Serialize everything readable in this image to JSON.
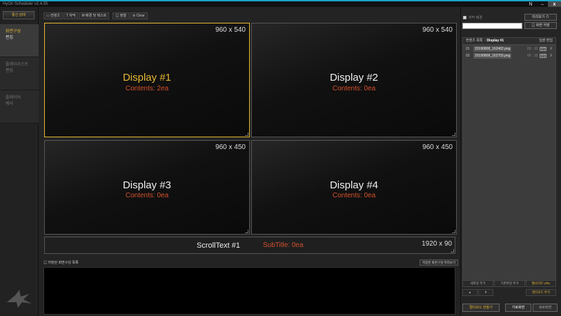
{
  "window": {
    "title": "HyOn Scheduler v2.4.55",
    "min_label": "‒",
    "close_label": "x",
    "n_label": "N"
  },
  "leftnav": {
    "comm_button": "통신 상태",
    "items": [
      {
        "line1": "화면구성",
        "line2": "편집"
      },
      {
        "line1": "플레이리스트",
        "line2": "편집"
      },
      {
        "line1": "플레이어",
        "line2": "에어"
      }
    ]
  },
  "toolbar": {
    "items": [
      "▭ 컨텐츠",
      "T 자막",
      "M 배경 및 텍스트",
      "▤ 정렬",
      "⊘ Clear"
    ]
  },
  "displays": [
    {
      "name": "Display #1",
      "contents": "Contents: 2ea",
      "resolution": "960 x 540"
    },
    {
      "name": "Display #2",
      "contents": "Contents: 0ea",
      "resolution": "960 x 540"
    },
    {
      "name": "Display #3",
      "contents": "Contents: 0ea",
      "resolution": "960 x 450"
    },
    {
      "name": "Display #4",
      "contents": "Contents: 0ea",
      "resolution": "960 x 450"
    }
  ],
  "scrolltext": {
    "name": "ScrollText #1",
    "subtitle": "SubTitle: 0ea",
    "resolution": "1920 x 90"
  },
  "saved": {
    "label": "▤ 저장된 화면구성 목록",
    "button": "저장된 화면구성 미리보기"
  },
  "right": {
    "checkbox_label": "자막 배경",
    "preview_button": "미리보기 ⊙",
    "name_input_value": "",
    "save_button": "▤ 화면 저장",
    "contents_header": "컨텐츠 목록",
    "display_selected": "· Display #1",
    "edit_label": "일괄 편집",
    "contents": [
      {
        "idx": "01",
        "file": "20190808_162402.png",
        "sec": "00 : 10",
        "cfg": "설정",
        "x": "X"
      },
      {
        "idx": "02",
        "file": "20190808_162703.png",
        "sec": "00 : 10",
        "cfg": "설정",
        "x": "X"
      }
    ],
    "add_new": "새파일 추가",
    "add_existing": "기존파일 추가",
    "website_url": "웹사이트 URL",
    "up": "▲",
    "down": "▼",
    "add_subtitle": "멀티모드 추가",
    "multimode_make": "멀티모드 만들기",
    "portrait": "가로화면",
    "landscape": "세로화면"
  }
}
